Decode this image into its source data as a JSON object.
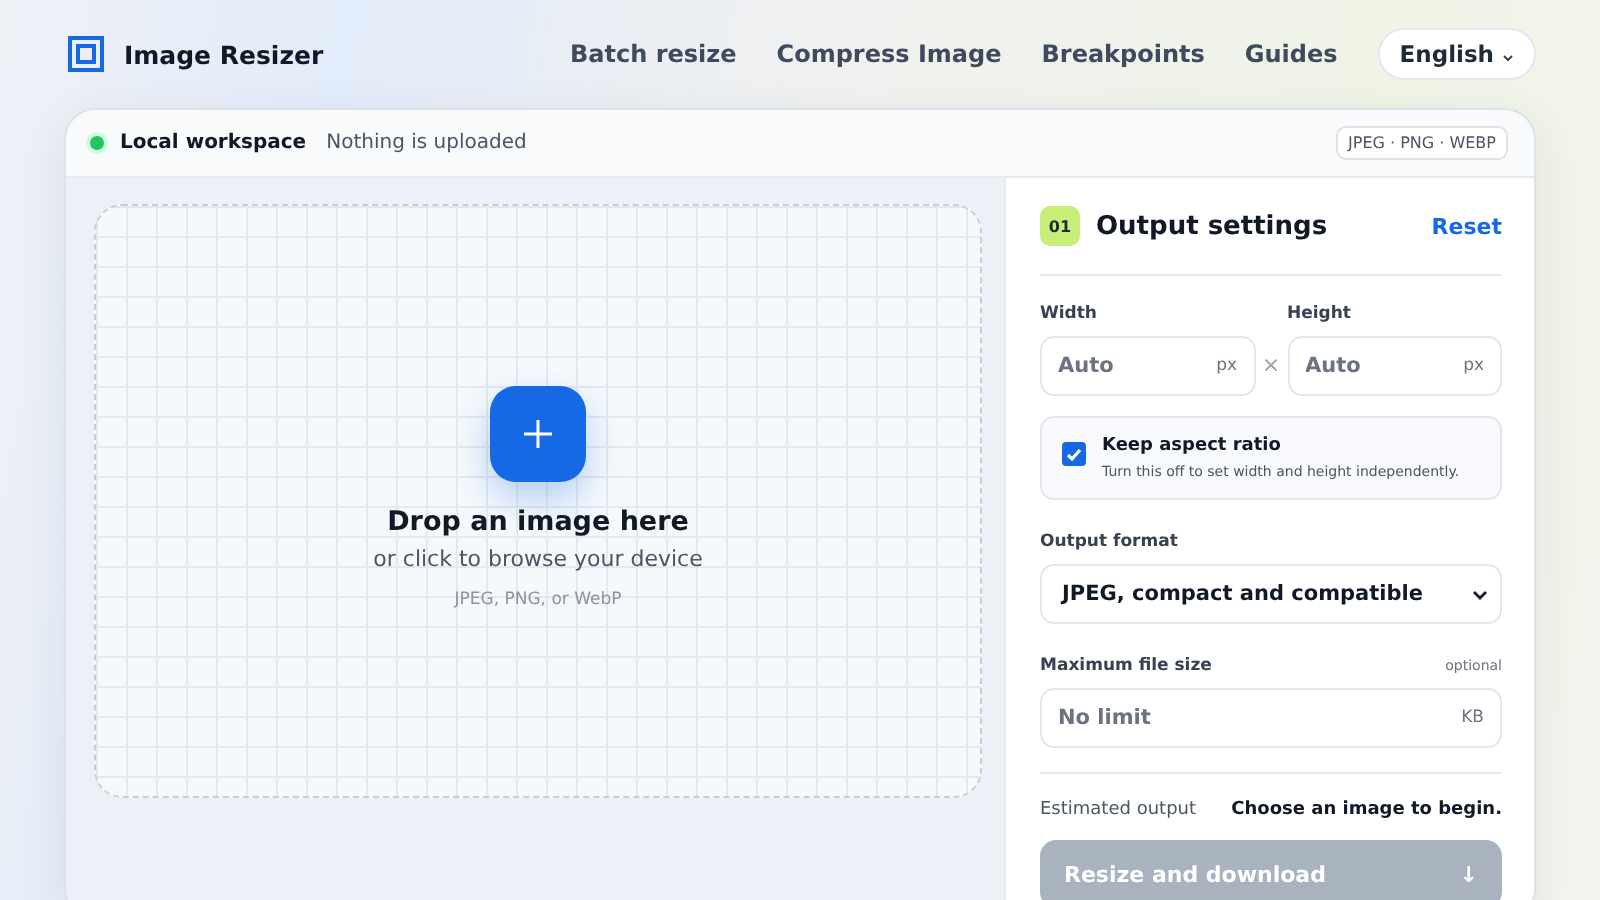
{
  "header": {
    "app_name": "Image Resizer",
    "nav": [
      "Batch resize",
      "Compress Image",
      "Breakpoints",
      "Guides"
    ],
    "language": "English"
  },
  "status_bar": {
    "online": true,
    "workspace": "Local workspace",
    "status": "Nothing is uploaded",
    "formats": "JPEG · PNG · WEBP"
  },
  "dropzone": {
    "title": "Drop an image here",
    "subtitle": "or click to browse your device",
    "formats": "JPEG, PNG, or WebP"
  },
  "settings": {
    "step": "01",
    "title": "Output settings",
    "reset": "Reset",
    "width": {
      "label": "Width",
      "placeholder": "Auto",
      "unit": "px"
    },
    "separator": "×",
    "height": {
      "label": "Height",
      "placeholder": "Auto",
      "unit": "px"
    },
    "aspect": {
      "label": "Keep aspect ratio",
      "hint": "Turn this off to set width and height independently.",
      "checked": true
    },
    "format": {
      "label": "Output format",
      "value": "JPEG, compact and compatible"
    },
    "max_size": {
      "label": "Maximum file size",
      "note": "optional",
      "placeholder": "No limit",
      "unit": "KB"
    },
    "estimate": {
      "label": "Estimated output",
      "value": "Choose an image to begin."
    },
    "action": {
      "label": "Resize and download",
      "icon": "↓",
      "disabled": true
    }
  }
}
